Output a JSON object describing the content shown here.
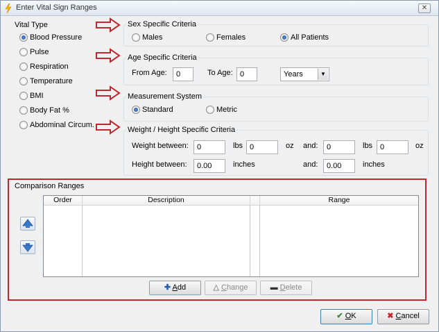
{
  "window": {
    "title": "Enter Vital Sign Ranges",
    "close_glyph": "✕"
  },
  "vital_type": {
    "title": "Vital Type",
    "options": [
      {
        "label": "Blood Pressure",
        "selected": true
      },
      {
        "label": "Pulse",
        "selected": false
      },
      {
        "label": "Respiration",
        "selected": false
      },
      {
        "label": "Temperature",
        "selected": false
      },
      {
        "label": "BMI",
        "selected": false
      },
      {
        "label": "Body Fat %",
        "selected": false
      },
      {
        "label": "Abdominal Circum.",
        "selected": false
      }
    ]
  },
  "sex_criteria": {
    "title": "Sex Specific Criteria",
    "options": [
      {
        "label": "Males",
        "selected": false
      },
      {
        "label": "Females",
        "selected": false
      },
      {
        "label": "All Patients",
        "selected": true
      }
    ]
  },
  "age_criteria": {
    "title": "Age Specific Criteria",
    "from_label": "From Age:",
    "from_value": "0",
    "to_label": "To Age:",
    "to_value": "0",
    "unit_value": "Years"
  },
  "measurement": {
    "title": "Measurement System",
    "options": [
      {
        "label": "Standard",
        "selected": true
      },
      {
        "label": "Metric",
        "selected": false
      }
    ]
  },
  "weight_height": {
    "title": "Weight / Height Specific Criteria",
    "weight_label": "Weight between:",
    "w1_lbs": "0",
    "lbs1": "lbs",
    "w1_oz": "0",
    "oz1": "oz",
    "and1": "and:",
    "w2_lbs": "0",
    "lbs2": "lbs",
    "w2_oz": "0",
    "oz2": "oz",
    "height_label": "Height between:",
    "h1": "0.00",
    "inches1": "inches",
    "and2": "and:",
    "h2": "0.00",
    "inches2": "inches"
  },
  "comparison": {
    "title": "Comparison Ranges",
    "columns": [
      "Order",
      "Description",
      "Range"
    ],
    "add_rest": "dd",
    "add_key": "A",
    "change_key": "C",
    "change_rest": "hange",
    "delete_key": "D",
    "delete_rest": "elete"
  },
  "footer": {
    "ok_key": "O",
    "ok_rest": "K",
    "cancel_key": "C",
    "cancel_rest": "ancel"
  },
  "colors": {
    "annotation_red": "#c1272d",
    "accent_blue": "#2a5ea8"
  }
}
